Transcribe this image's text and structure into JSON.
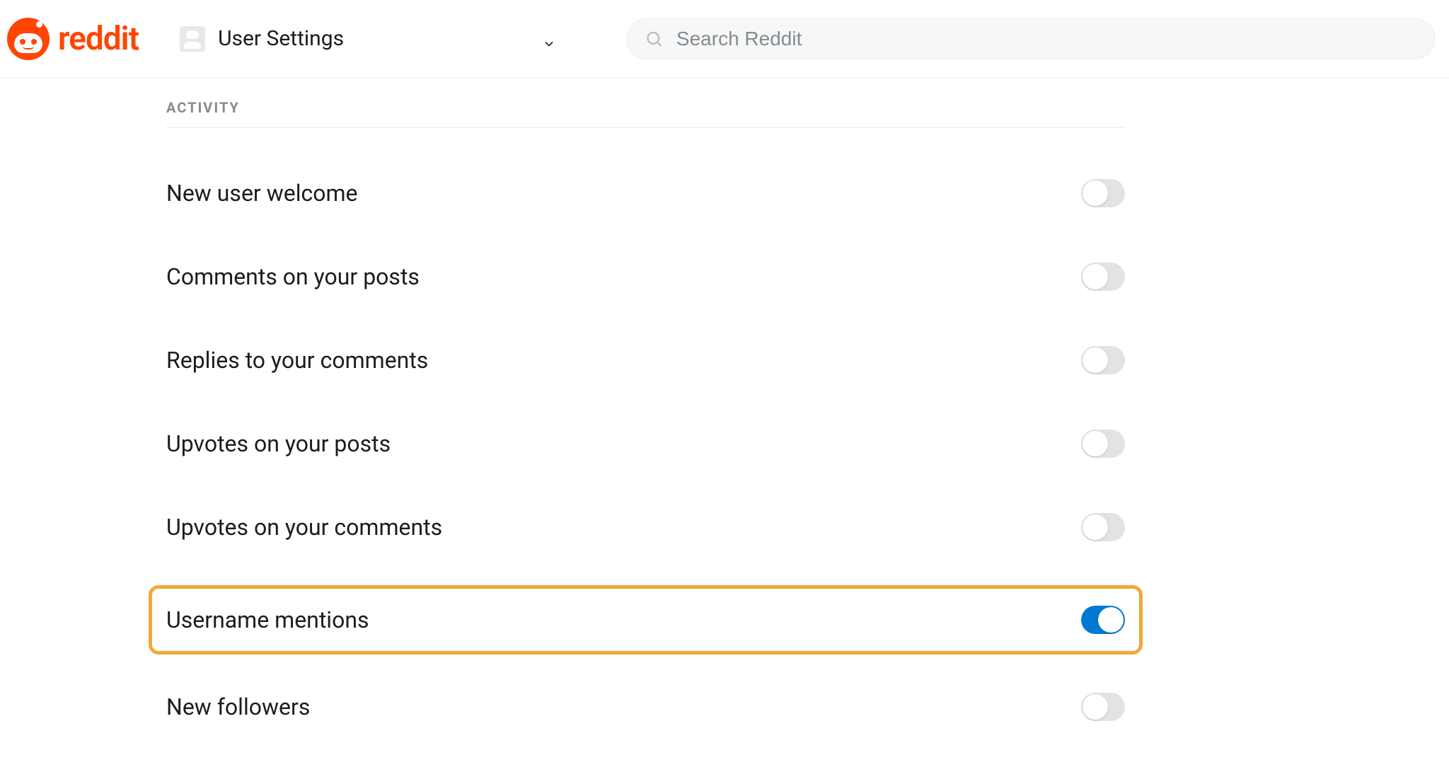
{
  "header": {
    "logo_text": "reddit",
    "nav_label": "User Settings",
    "search_placeholder": "Search Reddit"
  },
  "section": {
    "title": "ACTIVITY"
  },
  "settings": [
    {
      "label": "New user welcome",
      "on": false,
      "highlighted": false
    },
    {
      "label": "Comments on your posts",
      "on": false,
      "highlighted": false
    },
    {
      "label": "Replies to your comments",
      "on": false,
      "highlighted": false
    },
    {
      "label": "Upvotes on your posts",
      "on": false,
      "highlighted": false
    },
    {
      "label": "Upvotes on your comments",
      "on": false,
      "highlighted": false
    },
    {
      "label": "Username mentions",
      "on": true,
      "highlighted": true
    },
    {
      "label": "New followers",
      "on": false,
      "highlighted": false
    }
  ]
}
